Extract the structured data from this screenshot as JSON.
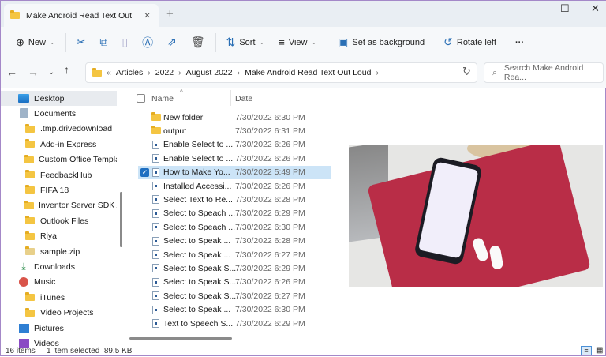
{
  "window": {
    "tab_title": "Make Android Read Text Out",
    "minimize": "–",
    "maximize": "☐",
    "close": "✕",
    "new_tab": "+",
    "tab_close": "✕"
  },
  "toolbar": {
    "new": "New",
    "sort": "Sort",
    "view": "View",
    "set_background": "Set as background",
    "rotate_left": "Rotate left",
    "more": "···"
  },
  "address": {
    "overflow": "«",
    "crumbs": [
      "Articles",
      "2022",
      "August 2022",
      "Make Android Read Text Out Loud"
    ],
    "search_placeholder": "Search Make Android Rea..."
  },
  "sidebar": {
    "items": [
      {
        "label": "Desktop",
        "type": "desktop",
        "indent": 0
      },
      {
        "label": "Documents",
        "type": "documents",
        "indent": 0
      },
      {
        "label": ".tmp.drivedownload",
        "type": "folder",
        "indent": 1
      },
      {
        "label": "Add-in Express",
        "type": "folder",
        "indent": 1
      },
      {
        "label": "Custom Office Templates",
        "type": "folder",
        "indent": 1
      },
      {
        "label": "FeedbackHub",
        "type": "folder",
        "indent": 1
      },
      {
        "label": "FIFA 18",
        "type": "folder",
        "indent": 1
      },
      {
        "label": "Inventor Server SDK ACAD",
        "type": "folder",
        "indent": 1
      },
      {
        "label": "Outlook Files",
        "type": "folder",
        "indent": 1
      },
      {
        "label": "Riya",
        "type": "folder",
        "indent": 1
      },
      {
        "label": "sample.zip",
        "type": "zip",
        "indent": 1
      },
      {
        "label": "Downloads",
        "type": "downloads",
        "indent": 0
      },
      {
        "label": "Music",
        "type": "music",
        "indent": 0
      },
      {
        "label": "iTunes",
        "type": "folder",
        "indent": 1
      },
      {
        "label": "Video Projects",
        "type": "folder",
        "indent": 1
      },
      {
        "label": "Pictures",
        "type": "pictures",
        "indent": 0
      },
      {
        "label": "Videos",
        "type": "videos",
        "indent": 0
      }
    ]
  },
  "columns": {
    "name": "Name",
    "date": "Date"
  },
  "files": [
    {
      "name": "New folder",
      "date": "7/30/2022 6:30 PM",
      "type": "folder"
    },
    {
      "name": "output",
      "date": "7/30/2022 6:31 PM",
      "type": "folder"
    },
    {
      "name": "Enable Select to ...",
      "date": "7/30/2022 6:26 PM",
      "type": "image"
    },
    {
      "name": "Enable Select to ...",
      "date": "7/30/2022 6:26 PM",
      "type": "image"
    },
    {
      "name": "How to Make Yo...",
      "date": "7/30/2022 5:49 PM",
      "type": "image",
      "selected": true
    },
    {
      "name": "Installed Accessi...",
      "date": "7/30/2022 6:26 PM",
      "type": "image"
    },
    {
      "name": "Select Text to Re...",
      "date": "7/30/2022 6:28 PM",
      "type": "image"
    },
    {
      "name": "Select to Speach ...",
      "date": "7/30/2022 6:29 PM",
      "type": "image"
    },
    {
      "name": "Select to Speach ...",
      "date": "7/30/2022 6:30 PM",
      "type": "image"
    },
    {
      "name": "Select to Speak ...",
      "date": "7/30/2022 6:28 PM",
      "type": "image"
    },
    {
      "name": "Select to Speak ...",
      "date": "7/30/2022 6:27 PM",
      "type": "image"
    },
    {
      "name": "Select to Speak S...",
      "date": "7/30/2022 6:29 PM",
      "type": "image"
    },
    {
      "name": "Select to Speak S...",
      "date": "7/30/2022 6:26 PM",
      "type": "image"
    },
    {
      "name": "Select to Speak S...",
      "date": "7/30/2022 6:27 PM",
      "type": "image"
    },
    {
      "name": "Select to Speak ...",
      "date": "7/30/2022 6:30 PM",
      "type": "image"
    },
    {
      "name": "Text to Speech S...",
      "date": "7/30/2022 6:29 PM",
      "type": "image"
    }
  ],
  "status": {
    "count": "16 items",
    "selection": "1 item selected  89.5 KB"
  }
}
